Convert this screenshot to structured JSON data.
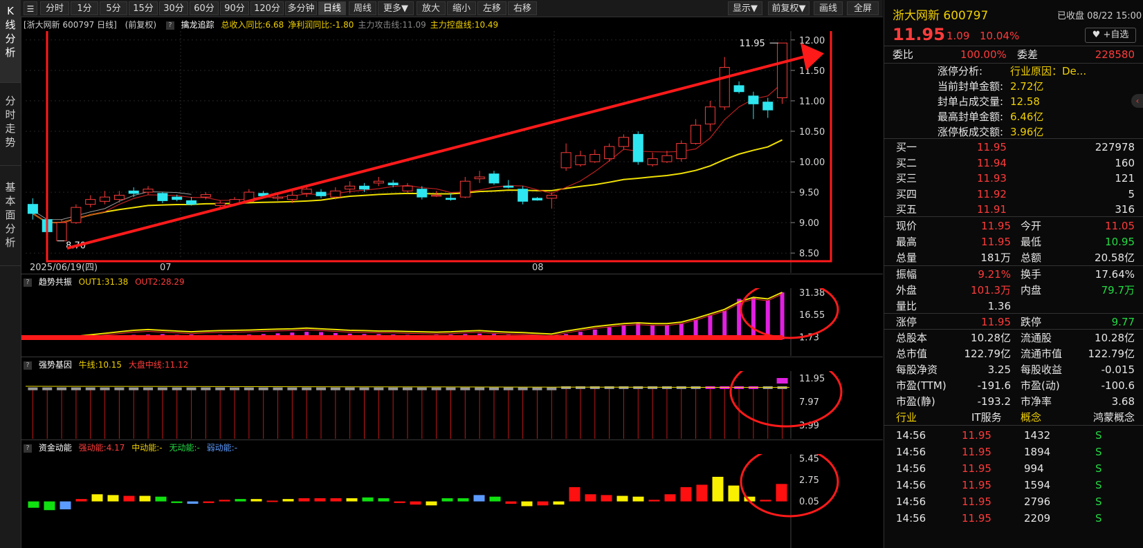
{
  "side_tabs": [
    [
      "K",
      "线",
      "分",
      "析"
    ],
    [
      "分",
      "时",
      "走",
      "势"
    ],
    [
      "基",
      "本",
      "面",
      "分",
      "析"
    ]
  ],
  "toolbar": {
    "buttons": [
      "分时",
      "1分",
      "5分",
      "15分",
      "30分",
      "60分",
      "90分",
      "120分",
      "多分钟",
      "日线",
      "周线",
      "更多▼",
      "放大",
      "缩小",
      "左移",
      "右移"
    ],
    "active": "日线",
    "right_buttons": [
      "显示▼",
      "前复权▼",
      "画线",
      "全屏"
    ]
  },
  "main_chart": {
    "header_prefix": "[浙大网新 600797 日线]",
    "header_adj": "(前复权)",
    "indicator_name": "擒龙追踪",
    "metrics": [
      {
        "text": "总收入同比:6.68",
        "color": "#f0d000"
      },
      {
        "text": "净利润同比:-1.80",
        "color": "#f0d000"
      },
      {
        "text": "主力攻击线:11.09",
        "color": "#888888"
      },
      {
        "text": "主力控盘线:10.49",
        "color": "#f0d000"
      }
    ],
    "y_ticks": [
      "12.00",
      "11.50",
      "11.00",
      "10.50",
      "10.00",
      "9.50",
      "9.00",
      "8.50"
    ],
    "high_label": "11.95",
    "low_label": "8.70",
    "date_labels": [
      "2025/06/19(四)",
      "07",
      "08"
    ]
  },
  "chart_data": [
    {
      "type": "candlestick",
      "title": "",
      "ylim": [
        8.4,
        12.1
      ],
      "candles": [
        [
          9.3,
          9.15,
          9.4,
          9.05
        ],
        [
          9.05,
          8.85,
          9.12,
          8.8
        ],
        [
          8.7,
          9.0,
          9.05,
          8.7
        ],
        [
          9.0,
          9.25,
          9.3,
          8.98
        ],
        [
          9.3,
          9.38,
          9.45,
          9.25
        ],
        [
          9.35,
          9.42,
          9.52,
          9.3
        ],
        [
          9.38,
          9.45,
          9.52,
          9.33
        ],
        [
          9.52,
          9.48,
          9.58,
          9.42
        ],
        [
          9.5,
          9.55,
          9.6,
          9.46
        ],
        [
          9.48,
          9.36,
          9.5,
          9.32
        ],
        [
          9.42,
          9.38,
          9.46,
          9.35
        ],
        [
          9.36,
          9.3,
          9.42,
          9.28
        ],
        [
          9.42,
          9.46,
          9.5,
          9.38
        ],
        [
          9.28,
          9.32,
          9.36,
          9.24
        ],
        [
          9.3,
          9.38,
          9.42,
          9.27
        ],
        [
          9.35,
          9.5,
          9.55,
          9.33
        ],
        [
          9.48,
          9.44,
          9.52,
          9.4
        ],
        [
          9.4,
          9.42,
          9.5,
          9.36
        ],
        [
          9.38,
          9.45,
          9.52,
          9.32
        ],
        [
          9.48,
          9.55,
          9.62,
          9.42
        ],
        [
          9.5,
          9.44,
          9.55,
          9.4
        ],
        [
          9.42,
          9.52,
          9.58,
          9.38
        ],
        [
          9.55,
          9.6,
          9.68,
          9.48
        ],
        [
          9.6,
          9.55,
          9.65,
          9.5
        ],
        [
          9.65,
          9.68,
          9.75,
          9.6
        ],
        [
          9.65,
          9.62,
          9.7,
          9.58
        ],
        [
          9.52,
          9.6,
          9.65,
          9.48
        ],
        [
          9.55,
          9.42,
          9.6,
          9.38
        ],
        [
          9.45,
          9.45,
          9.52,
          9.42
        ],
        [
          9.4,
          9.38,
          9.48,
          9.36
        ],
        [
          9.42,
          9.68,
          9.75,
          9.4
        ],
        [
          9.72,
          9.75,
          9.85,
          9.65
        ],
        [
          9.8,
          9.65,
          9.85,
          9.62
        ],
        [
          9.6,
          9.58,
          9.7,
          9.56
        ],
        [
          9.55,
          9.35,
          9.6,
          9.3
        ],
        [
          9.4,
          9.37,
          9.42,
          9.36
        ],
        [
          9.4,
          9.45,
          9.5,
          9.23
        ],
        [
          9.9,
          10.15,
          10.3,
          9.85
        ],
        [
          9.95,
          10.1,
          10.18,
          9.92
        ],
        [
          10.0,
          10.12,
          10.2,
          9.98
        ],
        [
          10.05,
          10.25,
          10.3,
          10.0
        ],
        [
          10.25,
          10.4,
          10.45,
          10.2
        ],
        [
          10.45,
          10.0,
          10.5,
          9.95
        ],
        [
          9.95,
          10.05,
          10.15,
          9.92
        ],
        [
          10.0,
          10.1,
          10.18,
          9.98
        ],
        [
          10.05,
          10.3,
          10.35,
          10.0
        ],
        [
          10.3,
          10.6,
          10.7,
          10.28
        ],
        [
          10.62,
          10.9,
          11.0,
          10.5
        ],
        [
          10.9,
          11.55,
          11.72,
          10.85
        ],
        [
          11.25,
          11.15,
          11.32,
          11.12
        ],
        [
          11.08,
          10.95,
          11.15,
          10.7
        ],
        [
          10.98,
          10.85,
          11.05,
          10.72
        ],
        [
          11.05,
          11.95,
          11.95,
          10.95
        ]
      ],
      "ma_lines": [
        {
          "name": "主力攻击线",
          "color": "#9a9a9a"
        },
        {
          "name": "主力控盘线",
          "color": "#f0e000"
        }
      ]
    },
    {
      "type": "bar",
      "title": "趋势共振",
      "series": [
        {
          "name": "OUT1",
          "value_label": "OUT1:31.38"
        },
        {
          "name": "OUT2",
          "value_label": "OUT2:28.29"
        }
      ],
      "y_ticks": [
        "31.38",
        "16.55",
        "1.73"
      ],
      "values": [
        1.0,
        0.5,
        0.2,
        0.5,
        1.2,
        1.8,
        2.5,
        3.0,
        3.2,
        3.5,
        3.0,
        3.2,
        2.8,
        3.0,
        2.9,
        3.2,
        3.5,
        4.0,
        4.5,
        5.0,
        4.8,
        4.2,
        3.8,
        3.5,
        3.5,
        3.2,
        3.0,
        2.8,
        3.0,
        3.2,
        3.5,
        3.8,
        3.5,
        3.0,
        2.8,
        2.5,
        1.5,
        3.5,
        5.0,
        6.5,
        8.0,
        9.5,
        10.5,
        9.5,
        9.5,
        10.5,
        13.0,
        16.0,
        19.0,
        27.0,
        28.0,
        26.0,
        31.38
      ],
      "line": [
        2.0,
        1.5,
        1.0,
        2.0,
        3.0,
        4.0,
        5.0,
        6.0,
        6.5,
        6.0,
        5.5,
        5.0,
        5.5,
        5.8,
        6.0,
        6.2,
        6.5,
        6.8,
        7.0,
        7.5,
        7.0,
        6.5,
        6.0,
        5.8,
        5.5,
        5.5,
        5.2,
        5.0,
        4.8,
        5.0,
        5.5,
        5.8,
        5.2,
        4.8,
        4.5,
        4.0,
        3.5,
        5.5,
        7.0,
        8.5,
        9.5,
        10.5,
        11.0,
        10.5,
        10.5,
        11.5,
        14.0,
        17.0,
        20.0,
        25.0,
        28.0,
        27.0,
        31.38
      ]
    },
    {
      "type": "bar",
      "title": "强势基因",
      "series": [
        {
          "name": "牛线",
          "value_label": "牛线:10.15"
        },
        {
          "name": "大盘中线",
          "value_label": "大盘中线:11.12"
        }
      ],
      "y_ticks": [
        "11.95",
        "7.97",
        "3.99"
      ]
    },
    {
      "type": "bar",
      "title": "资金动能",
      "series": [
        {
          "name": "强动能",
          "value_label": "强动能:4.17"
        },
        {
          "name": "中动能",
          "value_label": "中动能:-"
        },
        {
          "name": "无动能",
          "value_label": "无动能:-"
        },
        {
          "name": "弱动能",
          "value_label": "弱动能:-"
        }
      ],
      "y_ticks": [
        "5.45",
        "2.75",
        "0.05"
      ],
      "values": [
        -0.8,
        -1.1,
        -1.0,
        0.3,
        0.9,
        0.8,
        0.7,
        0.7,
        0.6,
        -0.2,
        -0.3,
        -0.2,
        0.2,
        0.3,
        0.3,
        0.1,
        0.3,
        0.4,
        0.4,
        0.4,
        0.4,
        0.5,
        0.4,
        -0.2,
        -0.4,
        -0.5,
        0.4,
        0.4,
        0.8,
        0.6,
        -0.3,
        -0.6,
        -0.5,
        -0.4,
        1.8,
        0.9,
        0.8,
        0.7,
        0.6,
        0.2,
        0.9,
        1.8,
        2.1,
        3.1,
        2.0,
        0.6,
        0.2,
        2.2
      ],
      "colors": [
        "green",
        "green",
        "blue",
        "red",
        "yellow",
        "yellow",
        "red",
        "yellow",
        "green",
        "green",
        "blue",
        "red",
        "red",
        "green",
        "yellow",
        "red",
        "yellow",
        "red",
        "red",
        "red",
        "yellow",
        "green",
        "green",
        "red",
        "red",
        "yellow",
        "green",
        "green",
        "blue",
        "green",
        "red",
        "yellow",
        "red",
        "yellow",
        "red",
        "red",
        "red",
        "yellow",
        "yellow",
        "red",
        "red",
        "red",
        "red",
        "yellow",
        "yellow",
        "yellow",
        "red",
        "red"
      ]
    }
  ],
  "panels": {
    "osc1": {
      "name": "趋势共振"
    },
    "osc2": {
      "name": "强势基因"
    },
    "osc3": {
      "name": "资金动能"
    }
  },
  "quote": {
    "name": "浙大网新 600797",
    "status": "已收盘 08/22 15:00",
    "price": "11.95",
    "change": "1.09",
    "pct": "10.04%",
    "fav": "+自选",
    "weibi_label": "委比",
    "weibi": "100.00%",
    "weicha_label": "委差",
    "weicha": "228580",
    "limit_info": [
      [
        "涨停分析:",
        "行业原因：De..."
      ],
      [
        "当前封单金额:",
        "2.72亿"
      ],
      [
        "封单占成交量:",
        "12.58"
      ],
      [
        "最高封单金额:",
        "6.46亿"
      ],
      [
        "涨停板成交额:",
        "3.96亿"
      ]
    ],
    "bids": [
      [
        "买一",
        "11.95",
        "227978"
      ],
      [
        "买二",
        "11.94",
        "160"
      ],
      [
        "买三",
        "11.93",
        "121"
      ],
      [
        "买四",
        "11.92",
        "5"
      ],
      [
        "买五",
        "11.91",
        "316"
      ]
    ],
    "stats": [
      [
        "现价",
        "11.95",
        "今开",
        "11.05"
      ],
      [
        "最高",
        "11.95",
        "最低",
        "10.95"
      ],
      [
        "总量",
        "181万",
        "总额",
        "20.58亿"
      ],
      [
        "振幅",
        "9.21%",
        "换手",
        "17.64%"
      ],
      [
        "外盘",
        "101.3万",
        "内盘",
        "79.7万"
      ],
      [
        "量比",
        "1.36",
        "",
        ""
      ],
      [
        "涨停",
        "11.95",
        "跌停",
        "9.77"
      ],
      [
        "总股本",
        "10.28亿",
        "流通股",
        "10.28亿"
      ],
      [
        "总市值",
        "122.79亿",
        "流通市值",
        "122.79亿"
      ],
      [
        "每股净资",
        "3.25",
        "每股收益",
        "-0.015"
      ],
      [
        "市盈(TTM)",
        "-191.6",
        "市盈(动)",
        "-100.6"
      ],
      [
        "市盈(静)",
        "-193.2",
        "市净率",
        "3.68"
      ]
    ],
    "industry": [
      "行业",
      "IT服务",
      "概念",
      "鸿蒙概念"
    ],
    "ticks": [
      [
        "14:56",
        "11.95",
        "1432",
        "S"
      ],
      [
        "14:56",
        "11.95",
        "1894",
        "S"
      ],
      [
        "14:56",
        "11.95",
        "994",
        "S"
      ],
      [
        "14:56",
        "11.95",
        "1594",
        "S"
      ],
      [
        "14:56",
        "11.95",
        "2796",
        "S"
      ],
      [
        "14:56",
        "11.95",
        "2209",
        "S"
      ]
    ]
  }
}
